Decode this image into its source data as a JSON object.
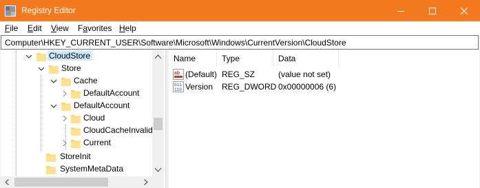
{
  "window": {
    "title": "Registry Editor",
    "accent": "#f37a1f"
  },
  "menu": [
    {
      "label": "File",
      "mnemonic": "F",
      "rest": "ile"
    },
    {
      "label": "Edit",
      "mnemonic": "E",
      "rest": "dit"
    },
    {
      "label": "View",
      "mnemonic": "V",
      "rest": "iew"
    },
    {
      "label": "Favorites",
      "mnemonic": "a",
      "pre": "F",
      "rest": "vorites"
    },
    {
      "label": "Help",
      "mnemonic": "H",
      "rest": "elp"
    }
  ],
  "address": {
    "path": "Computer\\HKEY_CURRENT_USER\\Software\\Microsoft\\Windows\\CurrentVersion\\CloudStore"
  },
  "tree": {
    "nodes": [
      {
        "label": "CloudStore",
        "state": "expanded",
        "selected": true,
        "level": 0
      },
      {
        "label": "Store",
        "state": "expanded",
        "level": 1
      },
      {
        "label": "Cache",
        "state": "expanded",
        "level": 2
      },
      {
        "label": "DefaultAccount",
        "state": "collapsed",
        "level": 3
      },
      {
        "label": "DefaultAccount",
        "state": "expanded",
        "level": 2
      },
      {
        "label": "Cloud",
        "state": "collapsed",
        "level": 3
      },
      {
        "label": "CloudCacheInvalid",
        "state": "leaf",
        "level": 3
      },
      {
        "label": "Current",
        "state": "collapsed",
        "level": 3
      },
      {
        "label": "StoreInit",
        "state": "leaf",
        "level": 0
      },
      {
        "label": "SystemMetaData",
        "state": "leaf",
        "level": 0
      }
    ]
  },
  "list": {
    "columns": [
      "Name",
      "Type",
      "Data"
    ],
    "rows": [
      {
        "icon": "string-value-icon",
        "name": "(Default)",
        "type": "REG_SZ",
        "data": "(value not set)"
      },
      {
        "icon": "binary-value-icon",
        "name": "Version",
        "type": "REG_DWORD",
        "data": "0x00000006 (6)"
      }
    ]
  }
}
